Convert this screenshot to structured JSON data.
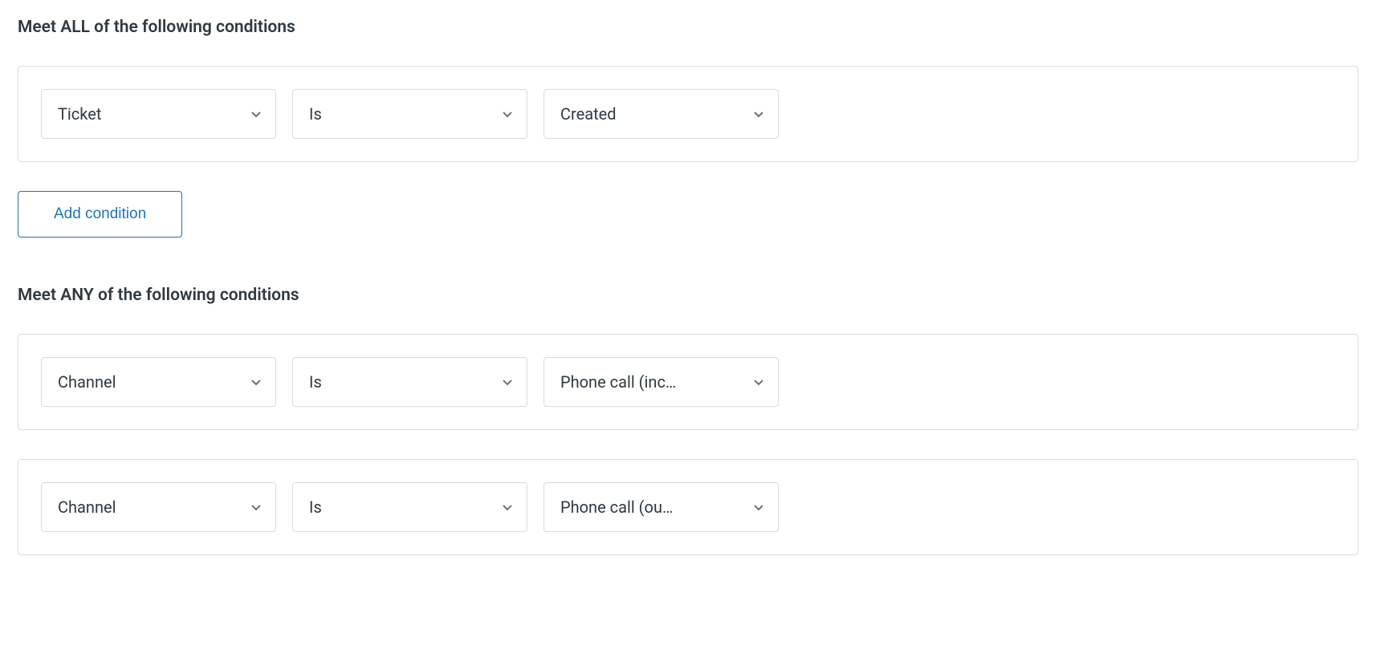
{
  "all_section": {
    "heading": "Meet ALL of the following conditions",
    "conditions": [
      {
        "field": "Ticket",
        "operator": "Is",
        "value": "Created"
      }
    ],
    "add_button_label": "Add condition"
  },
  "any_section": {
    "heading": "Meet ANY of the following conditions",
    "conditions": [
      {
        "field": "Channel",
        "operator": "Is",
        "value": "Phone call (inc…"
      },
      {
        "field": "Channel",
        "operator": "Is",
        "value": "Phone call (ou…"
      }
    ]
  }
}
